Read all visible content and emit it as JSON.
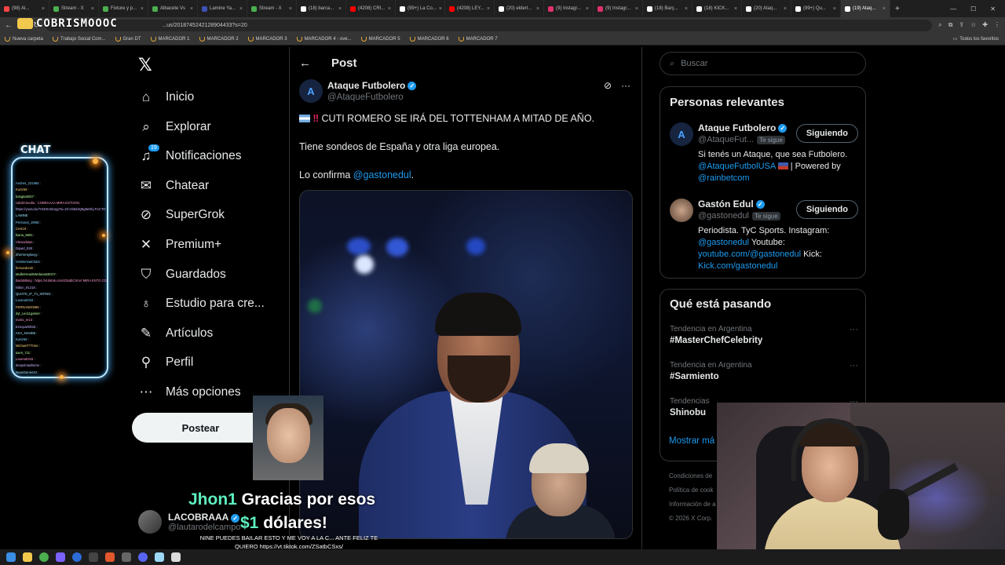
{
  "browser": {
    "tabs": [
      {
        "label": "(98) Al...",
        "color": "#ff4444",
        "active": false
      },
      {
        "label": "Stream - X",
        "color": "#4caf50",
        "active": false
      },
      {
        "label": "Fixture y p...",
        "color": "#4caf50",
        "active": false
      },
      {
        "label": "Albacete Vs",
        "color": "#4caf50",
        "active": false
      },
      {
        "label": "Lamine Ya...",
        "color": "#3f51b5",
        "active": false
      },
      {
        "label": "Stream - X",
        "color": "#4caf50",
        "active": false
      },
      {
        "label": "(18) barca...",
        "color": "#ffffff",
        "active": false
      },
      {
        "label": "(4208) CRI...",
        "color": "#ff0000",
        "active": false
      },
      {
        "label": "(99+) La Co...",
        "color": "#ffffff",
        "active": false
      },
      {
        "label": "(4208) LEY...",
        "color": "#ff0000",
        "active": false
      },
      {
        "label": "(20) elderl...",
        "color": "#ffffff",
        "active": false
      },
      {
        "label": "(9) Instagr...",
        "color": "#e1306c",
        "active": false
      },
      {
        "label": "(9) Instagr...",
        "color": "#e1306c",
        "active": false
      },
      {
        "label": "(18) Barç...",
        "color": "#ffffff",
        "active": false
      },
      {
        "label": "(18) KICK...",
        "color": "#ffffff",
        "active": false
      },
      {
        "label": "(20) Ataq...",
        "color": "#ffffff",
        "active": false
      },
      {
        "label": "(99+) Qu...",
        "color": "#ffffff",
        "active": false
      },
      {
        "label": "(19) Ataq...",
        "color": "#ffffff",
        "active": true
      }
    ],
    "url": "...us/2018745242128904433?s=20",
    "bookmarks": [
      "Nueva carpeta",
      "Trabajo Social Com...",
      "Gran DT",
      "MARCADOR 1",
      "MARCADOR 2",
      "MARCADOR 3",
      "MARCADOR 4 - ove...",
      "MARCADOR 5",
      "MARCADOR 6",
      "MARCADOR 7"
    ],
    "bookmarks_right": "Todos los favoritos"
  },
  "overlay_logo": "COBRISMOOOC",
  "nav": {
    "items": [
      {
        "label": "Inicio",
        "icon": "home-icon"
      },
      {
        "label": "Explorar",
        "icon": "search-icon"
      },
      {
        "label": "Notificaciones",
        "icon": "bell-icon",
        "badge": "19"
      },
      {
        "label": "Chatear",
        "icon": "mail-icon"
      },
      {
        "label": "SuperGrok",
        "icon": "grok-icon"
      },
      {
        "label": "Premium+",
        "icon": "x-icon"
      },
      {
        "label": "Guardados",
        "icon": "bookmark-icon"
      },
      {
        "label": "Estudio para cre...",
        "icon": "creator-studio-icon"
      },
      {
        "label": "Artículos",
        "icon": "articles-icon"
      },
      {
        "label": "Perfil",
        "icon": "person-icon"
      },
      {
        "label": "Más opciones",
        "icon": "more-icon"
      }
    ],
    "post_button": "Postear",
    "account": {
      "name": "LACOBRAAA",
      "handle": "@lautarodelcampo"
    }
  },
  "post": {
    "header_title": "Post",
    "author_name": "Ataque Futbolero",
    "author_handle": "@AtaqueFutbolero",
    "line1": "CUTI ROMERO SE IRÁ DEL TOTTENHAM A MITAD DE AÑO.",
    "line2": "Tiene sondeos de España y otra liga europea.",
    "line3_prefix": "Lo confirma",
    "line3_link": "@gastonedul",
    "line3_suffix": "."
  },
  "sidebar": {
    "search_placeholder": "Buscar",
    "relevant_title": "Personas relevantes",
    "people": [
      {
        "name": "Ataque Futbolero",
        "handle": "@AtaqueFut...",
        "follows_you": "Te sigue",
        "button": "Siguiendo",
        "bio_text": "Si tenés un Ataque, que sea Futbolero.",
        "bio_link1": "@AtaqueFutbolUSA",
        "bio_mid": " | Powered by",
        "bio_link2": "@rainbetcom"
      },
      {
        "name": "Gastón Edul",
        "handle": "@gastonedul",
        "follows_you": "Te sigue",
        "button": "Siguiendo",
        "bio_text": "Periodista. TyC Sports. Instagram:",
        "bio_link1": "@gastonedul",
        "bio_mid": " Youtube:",
        "bio_link2": "youtube.com/@gastonedul",
        "bio_mid2": " Kick:",
        "bio_link3": "Kick.com/gastonedul"
      }
    ],
    "trends_title": "Qué está pasando",
    "trends": [
      {
        "context": "Tendencia en Argentina",
        "topic": "#MasterChefCelebrity"
      },
      {
        "context": "Tendencia en Argentina",
        "topic": "#Sarmiento"
      },
      {
        "context": "Tendencias",
        "topic": "Shinobu"
      }
    ],
    "show_more": "Mostrar má",
    "footer": [
      "Condiciones de",
      "Política de cook",
      "Información de a",
      "© 2026 X Corp."
    ]
  },
  "stream": {
    "chat_title": "CHAT",
    "chat_lines": [
      "Andres_231966 :",
      "Kurtz69 :",
      "bangita0007 :",
      "cabrilAmedia : COBRAAAA MIRA ESTOOO,",
      "https://youtu.be/Y04rEo0iUqg?si=2rl-HiI5d4Q9g9eNbj FACTO DE",
      "LAMINE",
      "Personal_1996z :",
      "CH419 :",
      "kiana_6661 :",
      "Vlwoodstas :",
      "Dqwid_b39 :",
      "Zherreroylavyy :",
      "VonBonsaiClubs :",
      "fernanderok :",
      "MullerHeadsWebeast2EOY :",
      "BackBiking : https://vt.tiktok.com/ZSatbCSnV/ MIRA ESTO COBRO",
      "Nilton_91218 :",
      "QUOTE_IF_T1_INTING :",
      "Laurea0315 :",
      "FERNAND0086 :",
      "dyl_Leo11gamer :",
      "mario_m13 :",
      "Ezequiel0818 :",
      "AXA_NAHEB :",
      "Kurtz69 :",
      "Michael77Trote :",
      "axen_711 :",
      "Laurea0315 :",
      "despelotadisimo :",
      "IsaacDanieI10 :"
    ],
    "donation_name": "Jhon1",
    "donation_text": " Gracias por esos",
    "donation_amount": "$1",
    "donation_text2": " dólares!",
    "donation_message": "NINE PUEDES BAILAR ESTO Y ME VOY A LA C... ANTE FELIZ TE QUIERO https://vt.tiktok.com/ZSatbCSxs/"
  }
}
